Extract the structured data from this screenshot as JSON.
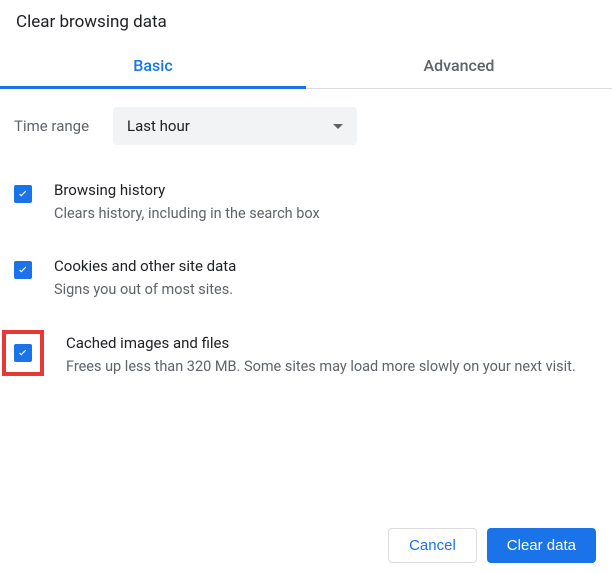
{
  "title": "Clear browsing data",
  "tabs": {
    "basic": "Basic",
    "advanced": "Advanced"
  },
  "time_range": {
    "label": "Time range",
    "selected": "Last hour"
  },
  "options": {
    "browsing": {
      "title": "Browsing history",
      "desc": "Clears history, including in the search box"
    },
    "cookies": {
      "title": "Cookies and other site data",
      "desc": "Signs you out of most sites."
    },
    "cache": {
      "title": "Cached images and files",
      "desc": "Frees up less than 320 MB. Some sites may load more slowly on your next visit."
    }
  },
  "buttons": {
    "cancel": "Cancel",
    "confirm": "Clear data"
  }
}
